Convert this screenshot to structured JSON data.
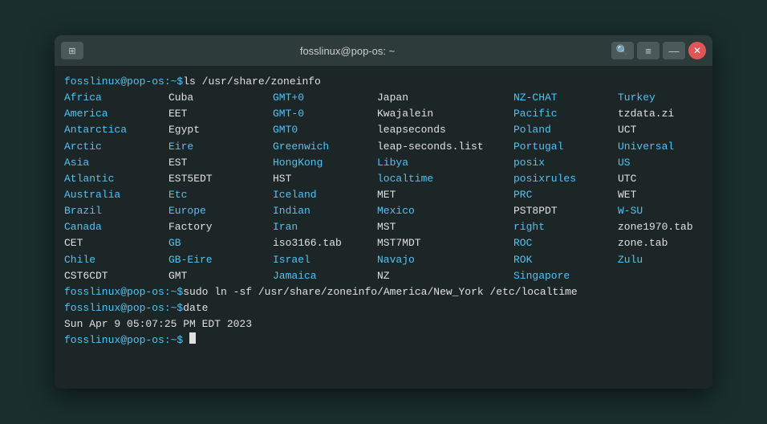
{
  "titlebar": {
    "title": "fosslinux@pop-os: ~",
    "tile_icon": "⊞",
    "search_icon": "🔍",
    "menu_icon": "≡",
    "minimize_icon": "—",
    "close_icon": "✕"
  },
  "terminal": {
    "prompt1": "fosslinux@pop-os:~$",
    "cmd1": " ls /usr/share/zoneinfo",
    "cols": [
      [
        "Africa",
        "America",
        "Antarctica",
        "Arctic",
        "Asia",
        "Atlantic",
        "Australia",
        "Brazil",
        "Canada",
        "CET",
        "Chile",
        "CST6CDT"
      ],
      [
        "Cuba",
        "EET",
        "Egypt",
        "Eire",
        "EST",
        "EST5EDT",
        "Etc",
        "Europe",
        "Factory",
        "GB",
        "GB-Eire",
        "GMT"
      ],
      [
        "GMT+0",
        "GMT-0",
        "GMT0",
        "Greenwich",
        "HongKong",
        "HST",
        "Iceland",
        "Indian",
        "Iran",
        "iso3166.tab",
        "Israel",
        "Jamaica"
      ],
      [
        "Japan",
        "Kwajalein",
        "leapseconds",
        "leap-seconds.list",
        "Libya",
        "localtime",
        "MET",
        "Mexico",
        "MST",
        "MST7MDT",
        "Navajo",
        "NZ"
      ],
      [
        "NZ-CHAT",
        "Pacific",
        "Poland",
        "Portugal",
        "posix",
        "posixrules",
        "PRC",
        "PST8PDT",
        "right",
        "ROC",
        "ROK",
        "Singapore"
      ],
      [
        "Turkey",
        "tzdata.zi",
        "UCT",
        "Universal",
        "US",
        "UTC",
        "WET",
        "W-SU",
        "zone1970.tab",
        "zone.tab",
        "Zulu",
        ""
      ]
    ],
    "col_colors": [
      "cyan",
      "white",
      "cyan",
      "white",
      "cyan",
      "white"
    ],
    "prompt2": "fosslinux@pop-os:~$",
    "cmd2": " sudo ln -sf /usr/share/zoneinfo/America/New_York /etc/localtime",
    "prompt3": "fosslinux@pop-os:~$",
    "cmd3": " date",
    "date_output": "Sun Apr  9 05:07:25 PM EDT 2023",
    "prompt4": "fosslinux@pop-os:~$"
  }
}
